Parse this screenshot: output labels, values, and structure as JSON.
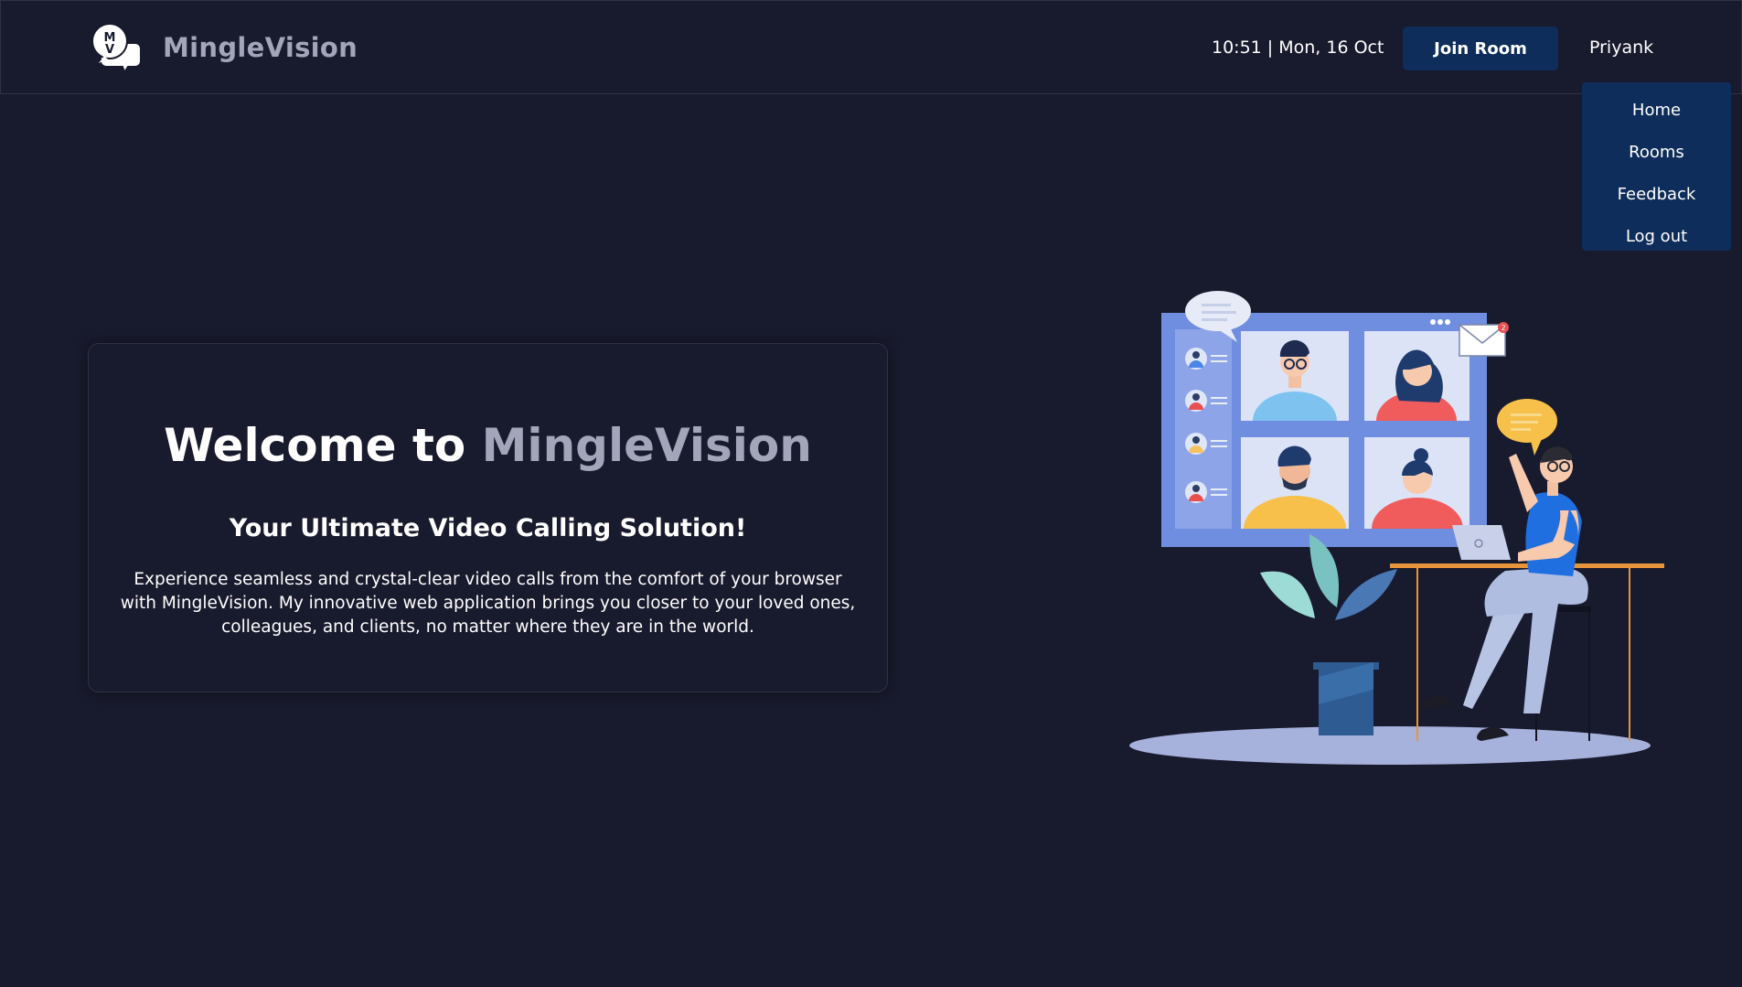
{
  "header": {
    "logo_letters": "MV",
    "brand_name": "MingleVision",
    "datetime": "10:51 | Mon, 16 Oct",
    "join_button": "Join Room",
    "user_name": "Priyank"
  },
  "dropdown": {
    "items": [
      "Home",
      "Rooms",
      "Feedback",
      "Log out"
    ]
  },
  "hero": {
    "title_prefix": "Welcome to",
    "title_brand": "MingleVision",
    "subtitle": "Your Ultimate Video Calling Solution!",
    "description": "Experience seamless and crystal-clear video calls from the comfort of your browser with MingleVision. My innovative web application brings you closer to your loved ones, colleagues, and clients, no matter where they are in the world."
  },
  "illustration": {
    "mail_badge": "2"
  },
  "colors": {
    "background": "#181a2d",
    "brand_muted": "#a3a6ba",
    "button": "#0e2d5a",
    "screen": "#6f8ee0"
  }
}
